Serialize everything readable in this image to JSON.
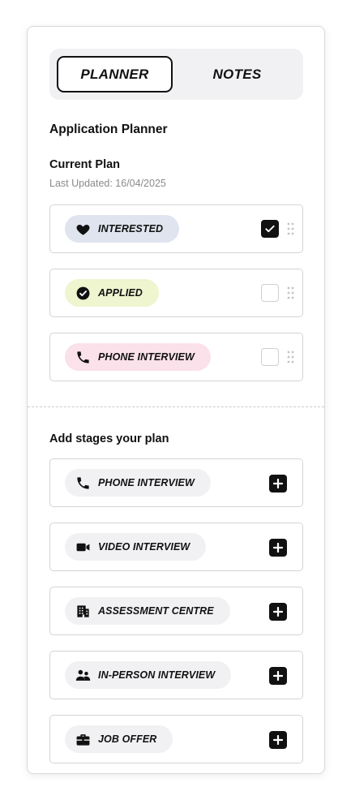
{
  "tabs": {
    "planner": "PLANNER",
    "notes": "NOTES"
  },
  "planner_title": "Application Planner",
  "current_plan": {
    "title": "Current Plan",
    "last_updated": "Last Updated: 16/04/2025",
    "stages": [
      {
        "label": "INTERESTED",
        "icon": "heart-icon",
        "checked": true,
        "color": "#dfe4ef"
      },
      {
        "label": "APPLIED",
        "icon": "check-circle-icon",
        "checked": false,
        "color": "#eef5cf"
      },
      {
        "label": "PHONE INTERVIEW",
        "icon": "phone-icon",
        "checked": false,
        "color": "#fbe1ea"
      }
    ]
  },
  "add_stages": {
    "title": "Add stages your plan",
    "items": [
      {
        "label": "PHONE INTERVIEW",
        "icon": "phone-icon"
      },
      {
        "label": "VIDEO INTERVIEW",
        "icon": "video-camera-icon"
      },
      {
        "label": "ASSESSMENT CENTRE",
        "icon": "building-icon"
      },
      {
        "label": "IN-PERSON INTERVIEW",
        "icon": "people-icon"
      },
      {
        "label": "JOB OFFER",
        "icon": "briefcase-icon"
      }
    ]
  }
}
